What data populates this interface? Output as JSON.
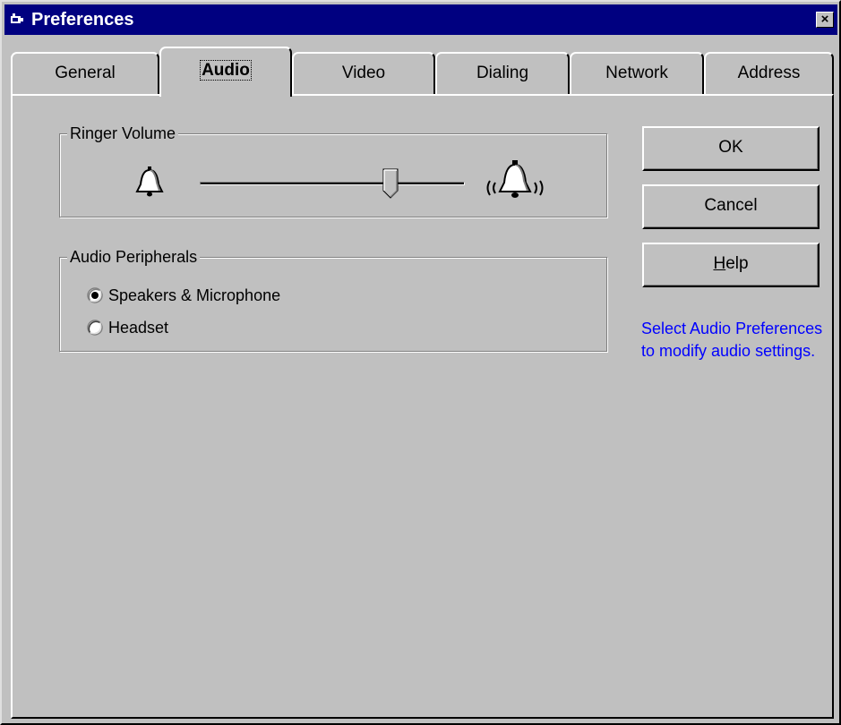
{
  "window": {
    "title": "Preferences",
    "close_label": "×"
  },
  "tabs": [
    {
      "label": "General",
      "active": false
    },
    {
      "label": "Audio",
      "active": true
    },
    {
      "label": "Video",
      "active": false
    },
    {
      "label": "Dialing",
      "active": false
    },
    {
      "label": "Network",
      "active": false
    },
    {
      "label": "Address",
      "active": false
    }
  ],
  "ringer_volume": {
    "label": "Ringer Volume",
    "level": 0.72,
    "min_icon": "bell-quiet-icon",
    "max_icon": "bell-ringing-icon"
  },
  "audio_peripherals": {
    "label": "Audio Peripherals",
    "options": [
      {
        "label": "Speakers & Microphone",
        "selected": true
      },
      {
        "label": "Headset",
        "selected": false
      }
    ]
  },
  "buttons": {
    "ok": "OK",
    "cancel": "Cancel",
    "help_mnemonic": "H",
    "help_rest": "elp"
  },
  "hint": {
    "text": "Select Audio Preferences to modify audio settings.",
    "color": "#0000ff"
  },
  "colors": {
    "titlebar": "#000080",
    "face": "#c0c0c0"
  }
}
